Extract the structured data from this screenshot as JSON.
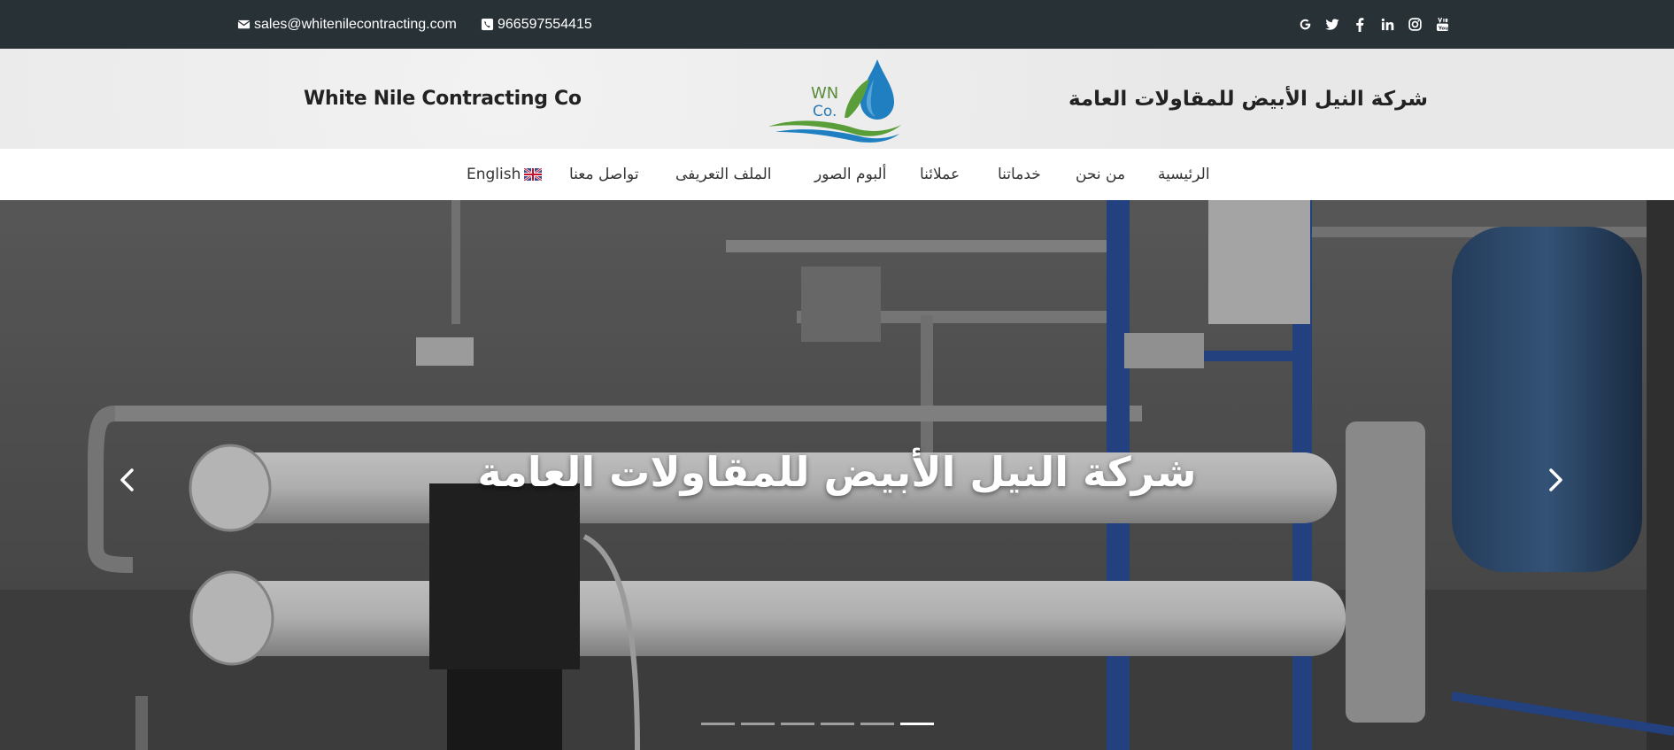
{
  "topbar": {
    "email": "sales@whitenilecontracting.com",
    "phone": "966597554415",
    "social": [
      {
        "icon": "google-icon",
        "glyph": "G"
      },
      {
        "icon": "twitter-icon",
        "glyph": ""
      },
      {
        "icon": "facebook-icon",
        "glyph": "f"
      },
      {
        "icon": "linkedin-icon",
        "glyph": "in"
      },
      {
        "icon": "instagram-icon",
        "glyph": ""
      },
      {
        "icon": "youtube-icon",
        "glyph": ""
      }
    ]
  },
  "header": {
    "title_en": "White Nile Contracting Co",
    "title_ar": "شركة النيل الأبيض للمقاولات العامة",
    "logo_text_1": "WN",
    "logo_text_2": "Co."
  },
  "nav": {
    "items": [
      {
        "label": "الرئيسية"
      },
      {
        "label": "من نحن"
      },
      {
        "label": "خدماتنا"
      },
      {
        "label": "عملائنا"
      },
      {
        "label": "ألبوم الصور"
      },
      {
        "label": "الملف التعريفى"
      },
      {
        "label": "تواصل معنا"
      },
      {
        "label": "English"
      }
    ]
  },
  "hero": {
    "caption": "شركة النيل الأبيض للمقاولات العامة",
    "active_slide": 6,
    "slide_count": 6
  },
  "colors": {
    "topbar_bg": "#273136",
    "header_bg": "#ececec",
    "logo_blue": "#1f7fc0",
    "logo_green": "#5a9e3a"
  }
}
